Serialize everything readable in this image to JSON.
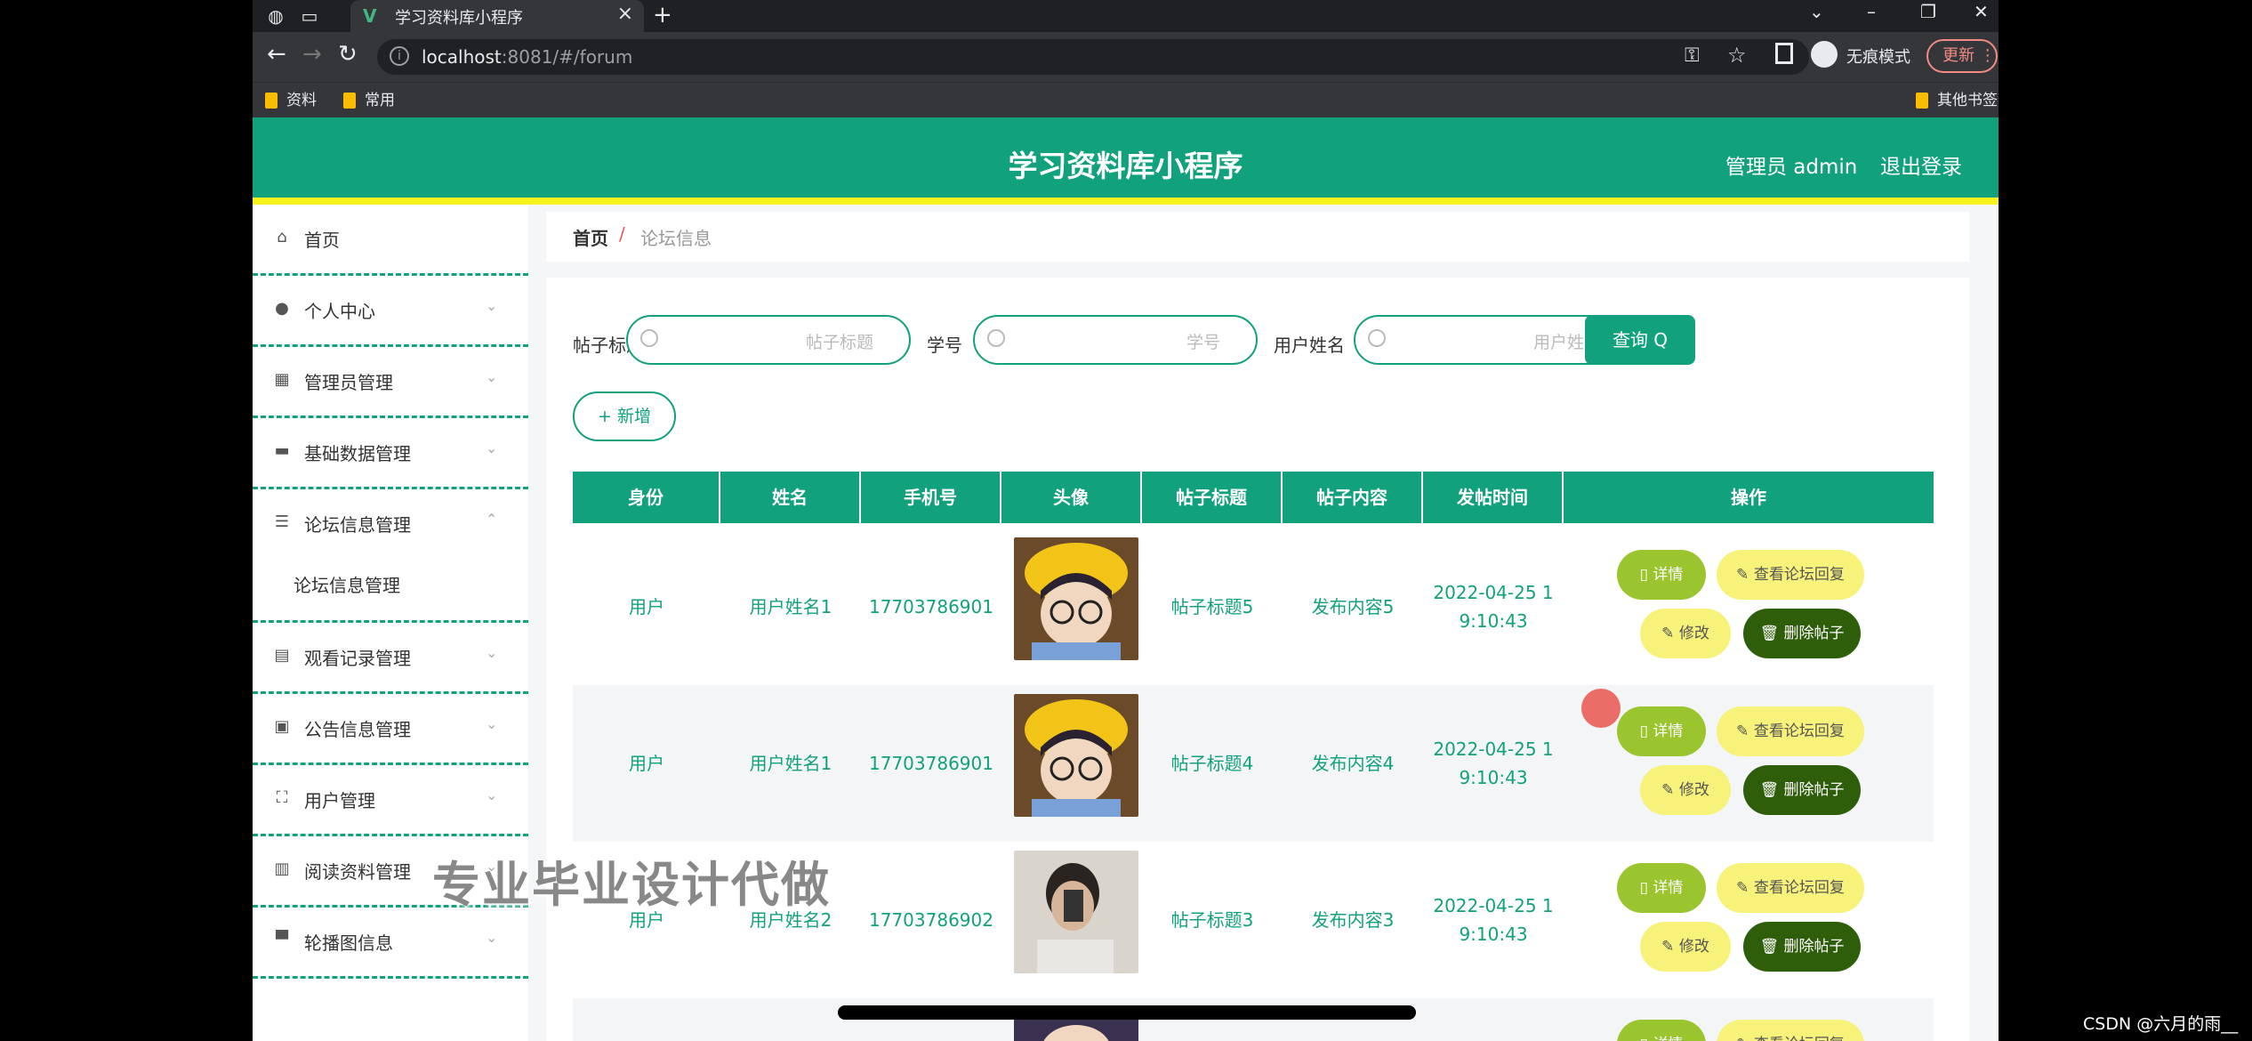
{
  "browser": {
    "tab_title": "学习资料库小程序",
    "url_host": "localhost",
    "url_rest": ":8081/#/forum",
    "incognito_label": "无痕模式",
    "update_label": "更新",
    "bookmarks": [
      "资料",
      "常用"
    ],
    "other_bookmarks": "其他书签"
  },
  "app": {
    "title": "学习资料库小程序",
    "user": "管理员 admin",
    "logout": "退出登录"
  },
  "sidebar": {
    "items": [
      {
        "label": "首页",
        "icon": "home-icon"
      },
      {
        "label": "个人中心",
        "icon": "user-icon"
      },
      {
        "label": "管理员管理",
        "icon": "chart-icon"
      },
      {
        "label": "基础数据管理",
        "icon": "chat-icon"
      },
      {
        "label": "论坛信息管理",
        "icon": "sliders-icon"
      },
      {
        "label": "观看记录管理",
        "icon": "briefcase-icon"
      },
      {
        "label": "公告信息管理",
        "icon": "clipboard-icon"
      },
      {
        "label": "用户管理",
        "icon": "frame-icon"
      },
      {
        "label": "阅读资料管理",
        "icon": "document-icon"
      },
      {
        "label": "轮播图信息",
        "icon": "monitor-icon"
      }
    ],
    "sub_item": "论坛信息管理"
  },
  "breadcrumb": {
    "home": "首页",
    "separator": "/",
    "current": "论坛信息"
  },
  "search": {
    "title_label": "帖子标题",
    "title_placeholder": "帖子标题",
    "id_label": "学号",
    "id_placeholder": "学号",
    "name_label": "用户姓名",
    "name_placeholder": "用户姓名",
    "query_button": "查询 Q",
    "add_button": "+ 新增"
  },
  "table": {
    "headers": [
      "身份",
      "姓名",
      "手机号",
      "头像",
      "帖子标题",
      "帖子内容",
      "发帖时间",
      "操作"
    ],
    "rows": [
      {
        "role": "用户",
        "name": "用户姓名1",
        "phone": "17703786901",
        "title": "帖子标题5",
        "content": "发布内容5",
        "time1": "2022-04-25 1",
        "time2": "9:10:43"
      },
      {
        "role": "用户",
        "name": "用户姓名1",
        "phone": "17703786901",
        "title": "帖子标题4",
        "content": "发布内容4",
        "time1": "2022-04-25 1",
        "time2": "9:10:43"
      },
      {
        "role": "用户",
        "name": "用户姓名2",
        "phone": "17703786902",
        "title": "帖子标题3",
        "content": "发布内容3",
        "time1": "2022-04-25 1",
        "time2": "9:10:43"
      }
    ],
    "actions": {
      "detail": "详情",
      "view_replies": "查看论坛回复",
      "edit": "修改",
      "delete": "删除帖子"
    }
  },
  "overlay": {
    "watermark": "专业毕业设计代做",
    "csdn": "CSDN @六月的雨__"
  },
  "colors": {
    "primary": "#12a17d",
    "accent_yellow": "#f7f21d",
    "danger": "#2f5e0a"
  }
}
